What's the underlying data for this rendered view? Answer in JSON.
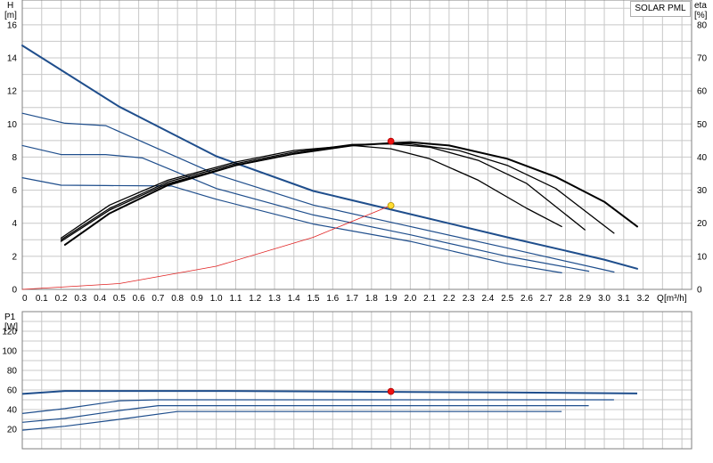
{
  "legend": {
    "text": "SOLAR PML"
  },
  "chart_data": [
    {
      "type": "line",
      "title": "",
      "x_label": "Q [m³/h]",
      "y_label": "H [m]",
      "y2_label": "eta [%]",
      "x_label_parts": {
        "name": "Q",
        "unit": "[m³/h]"
      },
      "y_label_parts": {
        "name": "H",
        "unit": "[m]"
      },
      "y2_label_parts": {
        "name": "eta",
        "unit": "[%]"
      },
      "x_ticks": [
        "0",
        "0.1",
        "0.2",
        "0.3",
        "0.4",
        "0.5",
        "0.6",
        "0.7",
        "0.8",
        "0.9",
        "1.0",
        "1.1",
        "1.2",
        "1.3",
        "1.4",
        "1.5",
        "1.6",
        "1.7",
        "1.8",
        "1.9",
        "2.0",
        "2.1",
        "2.2",
        "2.3",
        "2.4",
        "2.5",
        "2.6",
        "2.7",
        "2.8",
        "2.9",
        "3.0",
        "3.1",
        "3.2"
      ],
      "y_ticks": [
        "0",
        "2",
        "4",
        "6",
        "8",
        "10",
        "12",
        "14",
        "16"
      ],
      "y2_ticks": [
        "0",
        "10",
        "20",
        "30",
        "40",
        "50",
        "60",
        "70",
        "80"
      ],
      "xlim": [
        0,
        3.45
      ],
      "ylim": [
        0,
        17.5
      ],
      "y2lim": [
        0,
        87.5
      ],
      "grid": true,
      "colors": {
        "head": "#1f4e8c",
        "eta": "#000000",
        "system": "#e02020",
        "duty_eta": "#ee1111",
        "duty_head": "#ffdd33"
      },
      "series": [
        {
          "axis": "left",
          "x": [
            0,
            0.5,
            1.0,
            1.5,
            2.0,
            2.5,
            3.0,
            3.17
          ],
          "y": [
            14.75,
            11.05,
            8.05,
            5.95,
            4.55,
            3.15,
            1.8,
            1.25
          ]
        },
        {
          "axis": "left",
          "x": [
            0,
            0.22,
            0.43,
            1.0,
            1.5,
            2.0,
            2.5,
            3.05
          ],
          "y": [
            10.65,
            10.05,
            9.9,
            6.95,
            5.1,
            3.8,
            2.5,
            1.05
          ]
        },
        {
          "axis": "left",
          "x": [
            0,
            0.2,
            0.43,
            0.62,
            1.0,
            1.5,
            2.0,
            2.5,
            2.92
          ],
          "y": [
            8.7,
            8.15,
            8.15,
            7.95,
            6.1,
            4.5,
            3.3,
            2.0,
            1.1
          ]
        },
        {
          "axis": "left",
          "x": [
            0,
            0.2,
            0.43,
            0.77,
            1.0,
            1.5,
            2.0,
            2.5,
            2.78
          ],
          "y": [
            6.75,
            6.3,
            6.28,
            6.25,
            5.45,
            3.95,
            2.9,
            1.55,
            1.0
          ]
        },
        {
          "axis": "left",
          "x": [
            0,
            0.5,
            1.0,
            1.5,
            1.9
          ],
          "y": [
            0,
            0.35,
            1.4,
            3.15,
            5.07
          ]
        },
        {
          "axis": "right",
          "x": [
            0.22,
            0.45,
            0.75,
            1.1,
            1.4,
            1.7,
            1.9,
            2.0,
            2.2,
            2.5,
            2.75,
            3.0,
            3.17
          ],
          "y": [
            13.5,
            23.0,
            31.5,
            37.5,
            41.0,
            43.5,
            44.2,
            44.5,
            43.5,
            39.5,
            34.0,
            26.5,
            19.0
          ]
        },
        {
          "axis": "right",
          "x": [
            0.2,
            0.45,
            0.75,
            1.1,
            1.4,
            1.7,
            1.9,
            2.0,
            2.25,
            2.5,
            2.75,
            3.05
          ],
          "y": [
            14.5,
            24.0,
            32.0,
            37.5,
            41.0,
            43.5,
            44.2,
            44.0,
            42.0,
            37.5,
            30.5,
            17.0
          ]
        },
        {
          "axis": "right",
          "x": [
            0.2,
            0.45,
            0.75,
            1.1,
            1.4,
            1.7,
            1.9,
            2.1,
            2.35,
            2.6,
            2.9
          ],
          "y": [
            15.0,
            24.5,
            32.5,
            38.0,
            41.5,
            43.8,
            44.0,
            43.0,
            39.0,
            32.0,
            18.0
          ]
        },
        {
          "axis": "right",
          "x": [
            0.2,
            0.45,
            0.75,
            1.1,
            1.4,
            1.7,
            1.9,
            2.1,
            2.35,
            2.6,
            2.78
          ],
          "y": [
            15.5,
            25.5,
            33.0,
            38.5,
            42.0,
            43.5,
            42.5,
            39.5,
            33.0,
            24.5,
            19.0
          ]
        }
      ],
      "markers": [
        {
          "series": "eta",
          "x": 1.9,
          "y": 44.8
        },
        {
          "series": "head",
          "x": 1.9,
          "y": 5.07
        }
      ]
    },
    {
      "type": "line",
      "title": "",
      "y_label": "P1 [W]",
      "y_label_parts": {
        "name": "P1",
        "unit": "[W]"
      },
      "y_ticks": [
        "20",
        "40",
        "60",
        "80",
        "100",
        "120"
      ],
      "xlim": [
        0,
        3.45
      ],
      "ylim": [
        0,
        140
      ],
      "grid": true,
      "series": [
        {
          "x": [
            0,
            0.22,
            0.5,
            1.0,
            1.5,
            2.0,
            2.5,
            3.17
          ],
          "y": [
            56,
            59,
            59,
            59,
            58.5,
            58,
            57.5,
            56.5
          ]
        },
        {
          "x": [
            0,
            0.22,
            0.5,
            0.7,
            1.0,
            1.5,
            2.0,
            2.5,
            3.05
          ],
          "y": [
            36,
            41,
            49,
            50,
            50,
            50,
            50,
            50,
            50
          ]
        },
        {
          "x": [
            0,
            0.22,
            0.5,
            0.7,
            1.0,
            1.5,
            2.0,
            2.5,
            2.92
          ],
          "y": [
            27,
            31,
            39,
            44,
            44,
            44,
            44,
            44,
            44
          ]
        },
        {
          "x": [
            0,
            0.22,
            0.5,
            0.8,
            1.0,
            1.5,
            2.0,
            2.5,
            2.78
          ],
          "y": [
            19,
            23,
            30,
            38,
            38,
            38,
            38,
            38,
            38
          ]
        }
      ],
      "markers": [
        {
          "x": 1.9,
          "y": 58.5
        }
      ]
    }
  ]
}
